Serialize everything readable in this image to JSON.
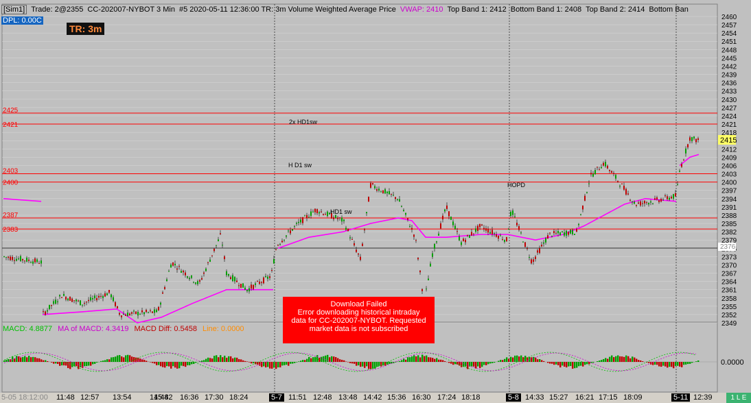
{
  "header": {
    "sim": "[Sim1]",
    "trade": "Trade: 2@2355",
    "symbol": "CC-202007-NYBOT  3 Min",
    "info": "#5 2020-05-11 12:36:00 TR: 3m Volume Weighted Average Price",
    "vwap": "VWAP: 2410",
    "top_band1": "Top Band 1: 2412",
    "bottom_band1": "Bottom Band 1: 2408",
    "top_band2": "Top Band 2: 2414",
    "bottom_band2": "Bottom Ban"
  },
  "dpl": "DPL: 0.00C",
  "tr_badge": "TR: 3m",
  "price_axis": {
    "ticks": [
      "2460",
      "2457",
      "2454",
      "2451",
      "2448",
      "2445",
      "2442",
      "2439",
      "2436",
      "2433",
      "2430",
      "2427",
      "2424",
      "2421",
      "2418",
      "2415",
      "2412",
      "2409",
      "2406",
      "2403",
      "2400",
      "2397",
      "2394",
      "2391",
      "2388",
      "2385",
      "2382",
      "2379",
      "2376",
      "2373",
      "2370",
      "2367",
      "2364",
      "2361",
      "2358",
      "2355",
      "2352",
      "2349"
    ],
    "current_price": "2415",
    "marker_price": "2376"
  },
  "level_labels": [
    {
      "text": "2425"
    },
    {
      "text": "2421"
    },
    {
      "text": "2403"
    },
    {
      "text": "2400"
    },
    {
      "text": "2387"
    },
    {
      "text": "2383"
    }
  ],
  "annotations": {
    "hd1sw_2x": "2x HD1sw",
    "hd1sw": "H D1 sw",
    "hopd": "HOPD",
    "hd1sw_low": "HD1 sw"
  },
  "download_error": {
    "title": "Download Failed",
    "line1": "Error downloading historical intraday",
    "line2": "data for CC-202007-NYBOT.  Requested",
    "line3": "market data is not subscribed"
  },
  "macd": {
    "macd": "MACD: 4.8877",
    "ma": "MA of MACD: 4.3419",
    "diff": "MACD Diff: 0.5458",
    "line": "Line: 0.0000",
    "axis_label": "0.0000"
  },
  "time_axis": {
    "labels": [
      {
        "t": "5-05 18:12:00",
        "kind": "first"
      },
      {
        "t": "11:48",
        "kind": "n"
      },
      {
        "t": "12:57",
        "kind": "n"
      },
      {
        "t": "13:54",
        "kind": "n"
      },
      {
        "t": "14:48",
        "kind": "n"
      },
      {
        "t": "15:42",
        "kind": "n"
      },
      {
        "t": "16:36",
        "kind": "n"
      },
      {
        "t": "17:30",
        "kind": "n"
      },
      {
        "t": "18:24",
        "kind": "n"
      },
      {
        "t": "5-7",
        "kind": "day"
      },
      {
        "t": "11:51",
        "kind": "n"
      },
      {
        "t": "12:48",
        "kind": "n"
      },
      {
        "t": "13:48",
        "kind": "n"
      },
      {
        "t": "14:42",
        "kind": "n"
      },
      {
        "t": "15:36",
        "kind": "n"
      },
      {
        "t": "16:30",
        "kind": "n"
      },
      {
        "t": "17:24",
        "kind": "n"
      },
      {
        "t": "18:18",
        "kind": "n"
      },
      {
        "t": "5-8",
        "kind": "day"
      },
      {
        "t": "14:33",
        "kind": "n"
      },
      {
        "t": "15:27",
        "kind": "n"
      },
      {
        "t": "16:21",
        "kind": "n"
      },
      {
        "t": "17:15",
        "kind": "n"
      },
      {
        "t": "18:09",
        "kind": "n"
      },
      {
        "t": "5-11",
        "kind": "day"
      },
      {
        "t": "12:39",
        "kind": "n"
      }
    ],
    "status": "1 L E"
  },
  "colors": {
    "up": "#00a000",
    "down": "#c00000",
    "vwap": "#ff00ff",
    "level": "#ff0000",
    "bg": "#c0c0c0",
    "grid": "#d8d8d8"
  }
}
